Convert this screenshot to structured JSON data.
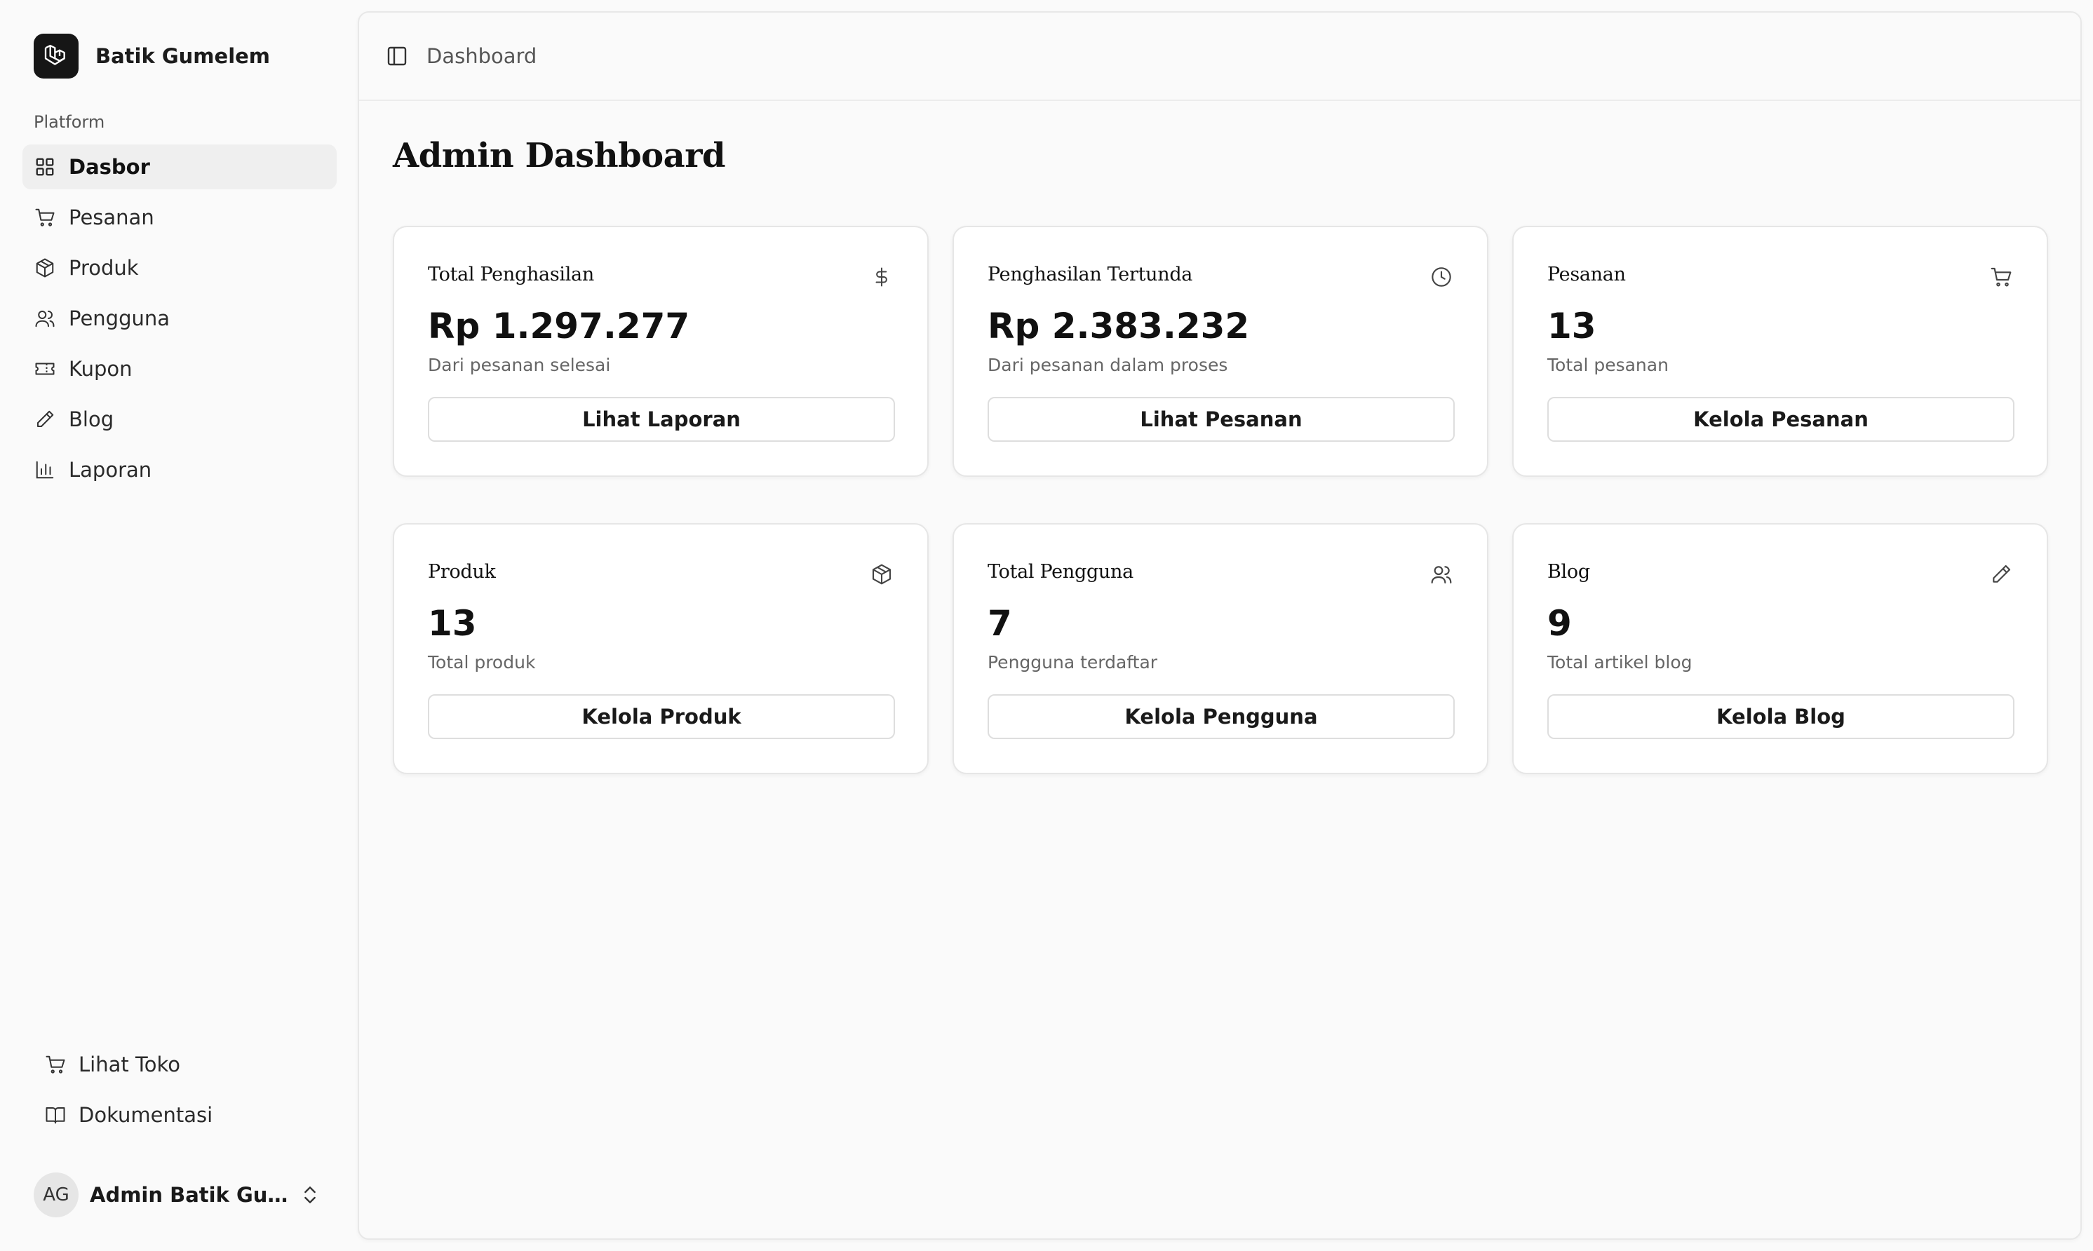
{
  "brand": {
    "name": "Batik Gumelem",
    "logo_icon": "laravel-logo-icon"
  },
  "sidebar": {
    "group_label": "Platform",
    "items": [
      {
        "label": "Dasbor",
        "icon": "grid-icon",
        "active": true
      },
      {
        "label": "Pesanan",
        "icon": "cart-icon",
        "active": false
      },
      {
        "label": "Produk",
        "icon": "box-icon",
        "active": false
      },
      {
        "label": "Pengguna",
        "icon": "users-icon",
        "active": false
      },
      {
        "label": "Kupon",
        "icon": "ticket-icon",
        "active": false
      },
      {
        "label": "Blog",
        "icon": "pencil-icon",
        "active": false
      },
      {
        "label": "Laporan",
        "icon": "bar-chart-icon",
        "active": false
      }
    ],
    "footer_items": [
      {
        "label": "Lihat Toko",
        "icon": "cart-icon"
      },
      {
        "label": "Dokumentasi",
        "icon": "book-icon"
      }
    ],
    "user": {
      "initials": "AG",
      "name": "Admin Batik Gume..."
    }
  },
  "header": {
    "breadcrumb": "Dashboard"
  },
  "page": {
    "title": "Admin Dashboard"
  },
  "cards": [
    {
      "title": "Total Penghasilan",
      "icon": "dollar-icon",
      "value": "Rp 1.297.277",
      "subtitle": "Dari pesanan selesai",
      "button": "Lihat Laporan"
    },
    {
      "title": "Penghasilan Tertunda",
      "icon": "clock-icon",
      "value": "Rp 2.383.232",
      "subtitle": "Dari pesanan dalam proses",
      "button": "Lihat Pesanan"
    },
    {
      "title": "Pesanan",
      "icon": "cart-icon",
      "value": "13",
      "subtitle": "Total pesanan",
      "button": "Kelola Pesanan"
    },
    {
      "title": "Produk",
      "icon": "box-icon",
      "value": "13",
      "subtitle": "Total produk",
      "button": "Kelola Produk"
    },
    {
      "title": "Total Pengguna",
      "icon": "users-icon",
      "value": "7",
      "subtitle": "Pengguna terdaftar",
      "button": "Kelola Pengguna"
    },
    {
      "title": "Blog",
      "icon": "pencil-icon",
      "value": "9",
      "subtitle": "Total artikel blog",
      "button": "Kelola Blog"
    }
  ],
  "colors": {
    "background": "#fafafa",
    "card": "#ffffff",
    "active_nav": "#efefef",
    "logo_bg": "#161616"
  }
}
